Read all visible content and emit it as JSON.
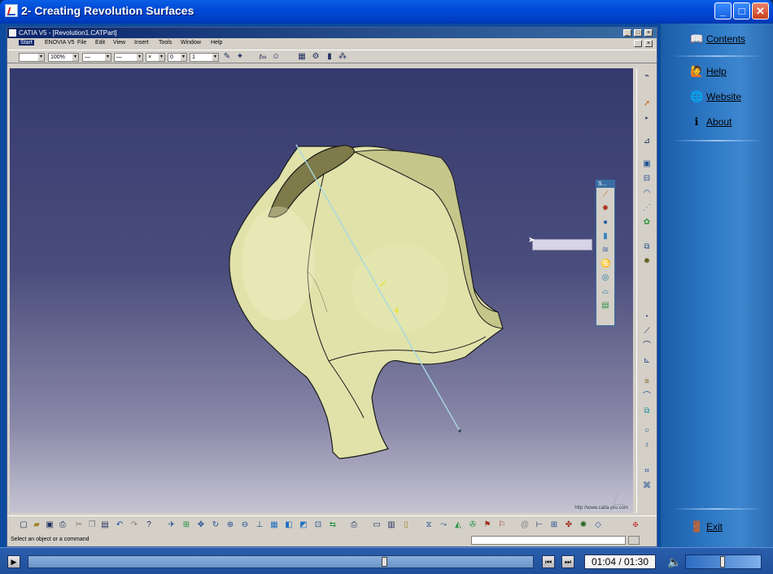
{
  "window": {
    "title": "2- Creating Revolution Surfaces",
    "buttons": {
      "minimize": "_",
      "maximize": "□",
      "close": "✕"
    }
  },
  "catia": {
    "title": "CATIA V5 - [Revolution1.CATPart]",
    "menu": [
      "Start",
      "ENOVIA V5",
      "File",
      "Edit",
      "View",
      "Insert",
      "Tools",
      "Window",
      "Help"
    ],
    "toolbar": {
      "zoom_combo": "100%",
      "num_combo": "0",
      "num_combo2": "1"
    },
    "status_message": "Select an object or a command",
    "watermark": "http://www.catia-pro.com",
    "palette_title": "S..."
  },
  "sidebar": {
    "items": [
      {
        "label": "Contents",
        "icon": "book-icon"
      },
      {
        "label": "Help",
        "icon": "help-icon"
      },
      {
        "label": "Website",
        "icon": "globe-icon"
      },
      {
        "label": "About",
        "icon": "info-icon"
      }
    ],
    "exit_label": "Exit"
  },
  "player": {
    "time": "01:04 / 01:30",
    "progress": 0.711,
    "volume": 0.5
  },
  "colors": {
    "surface_fill": "#e0e2aa",
    "surface_stroke": "#1a1a1a",
    "axis_line": "#a8d8e0",
    "sidebar_bg": "#2c76c2"
  }
}
